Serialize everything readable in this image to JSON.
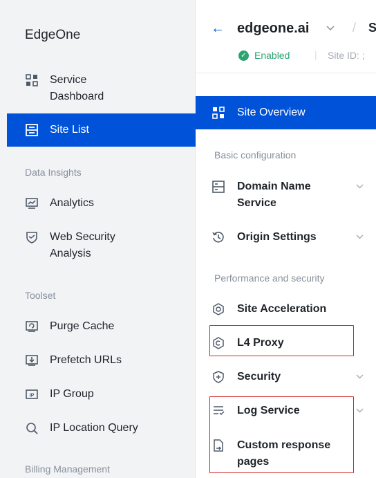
{
  "sidebar": {
    "brand": "EdgeOne",
    "items": [
      {
        "label": "Service\nDashboard",
        "icon": "grid-icon"
      },
      {
        "label": "Site List",
        "icon": "site-list-icon"
      }
    ],
    "groups": [
      {
        "title": "Data Insights",
        "items": [
          {
            "label": "Analytics",
            "icon": "analytics-icon"
          },
          {
            "label": "Web Security\nAnalysis",
            "icon": "shield-icon"
          }
        ]
      },
      {
        "title": "Toolset",
        "items": [
          {
            "label": "Purge Cache",
            "icon": "purge-icon"
          },
          {
            "label": "Prefetch URLs",
            "icon": "prefetch-icon"
          },
          {
            "label": "IP Group",
            "icon": "ip-icon"
          },
          {
            "label": "IP Location Query",
            "icon": "search-icon"
          }
        ]
      },
      {
        "title": "Billing Management",
        "items": []
      }
    ]
  },
  "site": {
    "back": "←",
    "name": "edgeone.ai",
    "separator": "/",
    "truncated": "S",
    "status": "Enabled",
    "site_id_label": "Site ID: ;"
  },
  "subnav": {
    "overview": "Site Overview",
    "basic_group": "Basic configuration",
    "domain": "Domain Name\nService",
    "origin": "Origin Settings",
    "perf_group": "Performance and security",
    "acceleration": "Site Acceleration",
    "l4proxy": "L4 Proxy",
    "security": "Security",
    "log": "Log Service",
    "custom": "Custom response\npages"
  },
  "colors": {
    "accent": "#0052d9",
    "success": "#2ba471",
    "highlight": "#d42323"
  }
}
